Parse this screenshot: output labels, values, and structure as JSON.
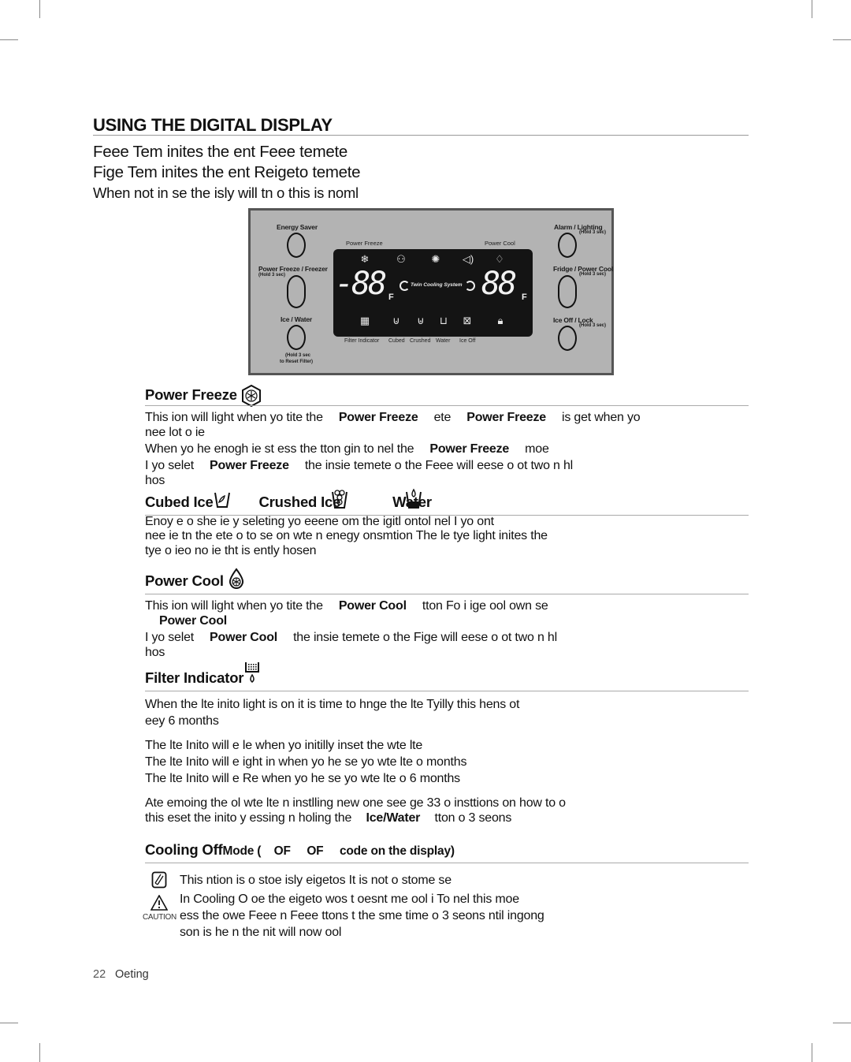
{
  "page": {
    "title": "USING THE DIGITAL DISPLAY",
    "intro": [
      "Feee Tem inites the ent Feee temete",
      "Fige Tem inites the ent Reigeto temete",
      "When not in se the isly will tn o this is noml"
    ]
  },
  "panel": {
    "left_buttons": [
      {
        "label": "Energy Saver",
        "sub": ""
      },
      {
        "label": "Power Freeze / Freezer",
        "sub": "(Hold 3 sec)"
      },
      {
        "label": "Ice / Water",
        "sub": ""
      }
    ],
    "left_bottom_note": [
      "(Hold 3 sec",
      "to Reset Filter)"
    ],
    "right_buttons": [
      {
        "label": "Alarm  /  Lighting",
        "sub": "(Hold 3 sec)"
      },
      {
        "label": "Fridge / Power Cool",
        "sub": "(Hold 3 sec)"
      },
      {
        "label": "Ice Off  /  Lock",
        "sub": "(Hold 3 sec)"
      }
    ],
    "top_labels": {
      "left": "Power Freeze",
      "right": "Power Cool"
    },
    "display": {
      "freezer_temp": "-88",
      "fridge_temp": "88",
      "unit": "F",
      "twin_cooling": "Twin Cooling System",
      "top_icons": [
        "snowflake-hex",
        "plug-alarm",
        "light-bulb",
        "speaker",
        "drop-snowflake"
      ],
      "bottom_icons": [
        "filter",
        "cubed-ice",
        "crushed-ice",
        "water",
        "ice-off",
        "lock"
      ]
    },
    "bottom_labels": [
      "Filter Indicator",
      "Cubed",
      "Crushed",
      "Water",
      "Ice Off"
    ]
  },
  "sections": {
    "power_freeze": {
      "heading": "Power Freeze",
      "lines": [
        {
          "parts": [
            {
              "t": "This ion will light  when yo tite the"
            },
            {
              "t": "Power Freeze",
              "b": true
            },
            {
              "t": "ete"
            },
            {
              "t": "Power Freeze",
              "b": true
            },
            {
              "t": "is get when yo"
            }
          ]
        },
        {
          "parts": [
            {
              "t": "nee  lot o ie"
            }
          ]
        },
        {
          "parts": [
            {
              "t": "When yo he enogh ie st ess the tton gin to nel the"
            },
            {
              "t": "Power Freeze",
              "b": true
            },
            {
              "t": "moe"
            }
          ]
        },
        {
          "parts": [
            {
              "t": "I yo selet"
            },
            {
              "t": "Power Freeze",
              "b": true
            },
            {
              "t": "the insie temete o the Feee will eese o ot two n  hl"
            }
          ]
        },
        {
          "parts": [
            {
              "t": "hos"
            }
          ]
        }
      ]
    },
    "ice_water": {
      "headings": [
        "Cubed Ice",
        "Crushed Ice",
        "Water"
      ],
      "lines": [
        "Enoy e o she ie y seleting yo eeene om the igitl ontol nel I yo ont",
        "nee ie tn the ete o to se on wte n enegy onsmtion The le tye light inites the",
        "tye o ieo no ie tht is ently hosen"
      ]
    },
    "power_cool": {
      "heading": "Power Cool",
      "lines": [
        {
          "parts": [
            {
              "t": "This ion will light  when yo tite the"
            },
            {
              "t": "Power Cool",
              "b": true
            },
            {
              "t": "tton Fo  i ige ool own se"
            }
          ]
        },
        {
          "parts": [
            {
              "t": "Power Cool",
              "b": true
            }
          ]
        },
        {
          "parts": [
            {
              "t": "I yo selet"
            },
            {
              "t": "Power Cool",
              "b": true
            },
            {
              "t": "the insie temete o the Fige will eese o ot two n  hl"
            }
          ]
        },
        {
          "parts": [
            {
              "t": "hos"
            }
          ]
        }
      ]
    },
    "filter": {
      "heading": "Filter Indicator",
      "lines": [
        "When the lte inito light is on it is time to hnge the lte Tyilly this hens ot",
        "eey 6 months",
        "The lte Inito will e le when yo initilly inset the wte lte",
        "The lte Inito will e ight in when yo he se yo wte lte o  months",
        "The lte Inito will e Re when yo he se yo wte lte o 6 months",
        "Ate emoing the ol wte lte n instlling  new one see ge 33 o insttions on how to o"
      ],
      "last_line": {
        "pre": "this eset the inito y essing n holing the",
        "bold": "Ice/Water",
        "post": "tton o 3 seons"
      }
    },
    "cooling_off": {
      "heading_big": "Cooling Off",
      "heading_small": "Mode (    OF     OF     code on the display)",
      "note": "This ntion is o stoe isly eigetos It is not o stome se",
      "caution_label": "CAUTION",
      "caution_lines": [
        "In Cooling O oe the eigeto wos t oesnt me ool i To nel this moe",
        "ess the owe Feee n Feee ttons t the sme time o 3 seons ntil  ingong",
        "son is he n the nit will now ool"
      ]
    }
  },
  "footer": {
    "page_number": "22",
    "section": "Oeting"
  }
}
